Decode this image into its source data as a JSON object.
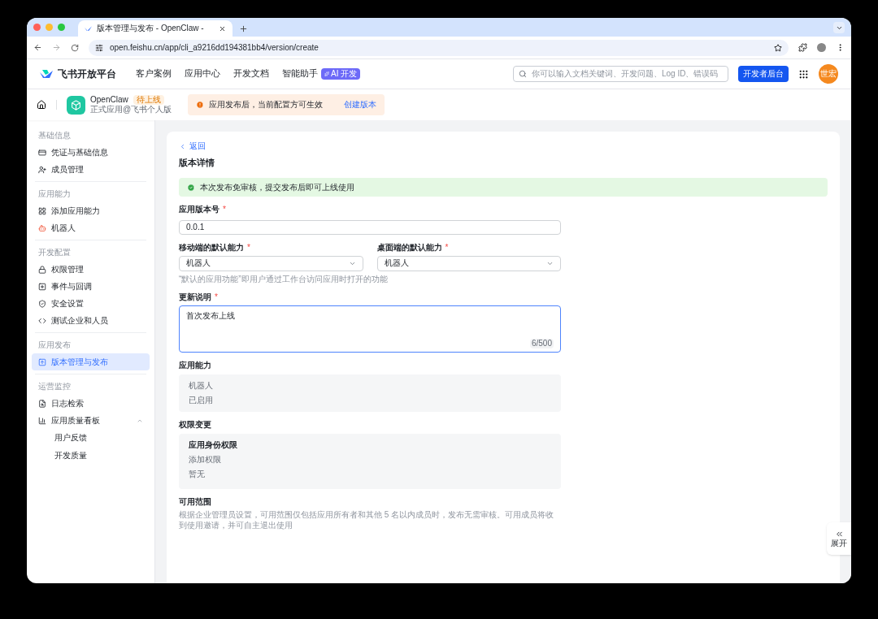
{
  "browser": {
    "tab_title": "版本管理与发布 - OpenClaw -",
    "url": "open.feishu.cn/app/cli_a9216dd194381bb4/version/create"
  },
  "header": {
    "logo_text": "飞书开放平台",
    "nav": [
      {
        "label": "客户案例"
      },
      {
        "label": "应用中心"
      },
      {
        "label": "开发文档"
      },
      {
        "label": "智能助手",
        "badge": "AI 开发"
      }
    ],
    "search_placeholder": "你可以输入文档关键词、开发问题、Log ID、错误码",
    "console_button": "开发者后台",
    "avatar_text": "世宏"
  },
  "app_bar": {
    "app_name": "OpenClaw",
    "status_badge": "待上线",
    "app_subtitle": "正式应用@飞书个人版",
    "notice": "应用发布后，当前配置方可生效",
    "notice_link": "创建版本"
  },
  "sidebar": {
    "sections": [
      {
        "title": "基础信息",
        "items": [
          {
            "label": "凭证与基础信息",
            "selected": false
          },
          {
            "label": "成员管理",
            "selected": false
          }
        ]
      },
      {
        "title": "应用能力",
        "items": [
          {
            "label": "添加应用能力",
            "selected": false
          },
          {
            "label": "机器人",
            "selected": false
          }
        ]
      },
      {
        "title": "开发配置",
        "items": [
          {
            "label": "权限管理",
            "selected": false
          },
          {
            "label": "事件与回调",
            "selected": false
          },
          {
            "label": "安全设置",
            "selected": false
          },
          {
            "label": "测试企业和人员",
            "selected": false
          }
        ]
      },
      {
        "title": "应用发布",
        "items": [
          {
            "label": "版本管理与发布",
            "selected": true
          }
        ]
      },
      {
        "title": "运营监控",
        "items": [
          {
            "label": "日志检索",
            "selected": false
          },
          {
            "label": "应用质量看板",
            "selected": false,
            "expanded": true,
            "children": [
              {
                "label": "用户反馈",
                "selected": false
              },
              {
                "label": "开发质量",
                "selected": false
              }
            ]
          }
        ]
      }
    ]
  },
  "main": {
    "back": "返回",
    "title": "版本详情",
    "alert": "本次发布免审核，提交发布后即可上线使用",
    "version": {
      "label": "应用版本号",
      "mark": "*",
      "value": "0.0.1"
    },
    "selects": [
      {
        "label": "移动端的默认能力",
        "mark": "*",
        "value": "机器人"
      },
      {
        "label": "桌面端的默认能力",
        "mark": "*",
        "value": "机器人"
      }
    ],
    "select_hint": "“默认的应用功能”即用户通过工作台访问应用时打开的功能",
    "notes": {
      "label": "更新说明",
      "mark": "*",
      "value": "首次发布上线",
      "counter": "6/500"
    },
    "capability": {
      "title": "应用能力",
      "lines": [
        "机器人",
        "已启用"
      ]
    },
    "permissions": {
      "title": "权限变更",
      "heading": "应用身份权限",
      "lines": [
        "添加权限",
        "暂无"
      ]
    },
    "scope": {
      "title": "可用范围",
      "description": "根据企业管理员设置，可用范围仅包括应用所有者和其他 5 名以内成员时，发布无需审核。可用成员将收到使用邀请，并可自主退出使用"
    }
  },
  "expand_button": "展开"
}
